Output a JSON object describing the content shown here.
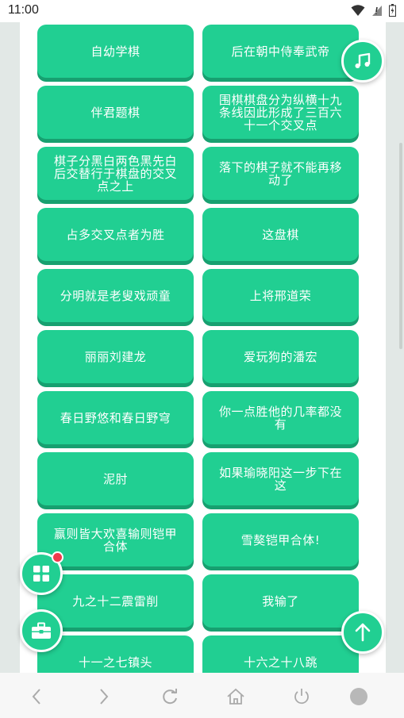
{
  "status_bar": {
    "time": "11:00"
  },
  "buttons": [
    "自幼学棋",
    "后在朝中侍奉武帝",
    "伴君题棋",
    "围棋棋盘分为纵横十九条线因此形成了三百六十一个交叉点",
    "棋子分黑白两色黑先白后交替行于棋盘的交叉点之上",
    "落下的棋子就不能再移动了",
    "占多交叉点者为胜",
    "这盘棋",
    "分明就是老叟戏顽童",
    "上将邢道荣",
    "丽丽刘建龙",
    "爱玩狗的潘宏",
    "春日野悠和春日野穹",
    "你一点胜他的几率都没有",
    "泥肘",
    "如果瑜晓阳这一步下在这",
    "赢则皆大欢喜输则铠甲合体",
    "雪獒铠甲合体!",
    "九之十二震雷削",
    "我输了",
    "十一之七镇头",
    "十六之十八跳"
  ],
  "floating_buttons": {
    "music": "music-note-icon",
    "apps": "grid-icon",
    "toolbox": "toolbox-icon",
    "scroll_top": "arrow-up-icon"
  },
  "colors": {
    "button_green": "#21cf92",
    "button_shadow": "#17a070",
    "badge_red": "#f03a4c",
    "background": "#e2e8e6"
  }
}
